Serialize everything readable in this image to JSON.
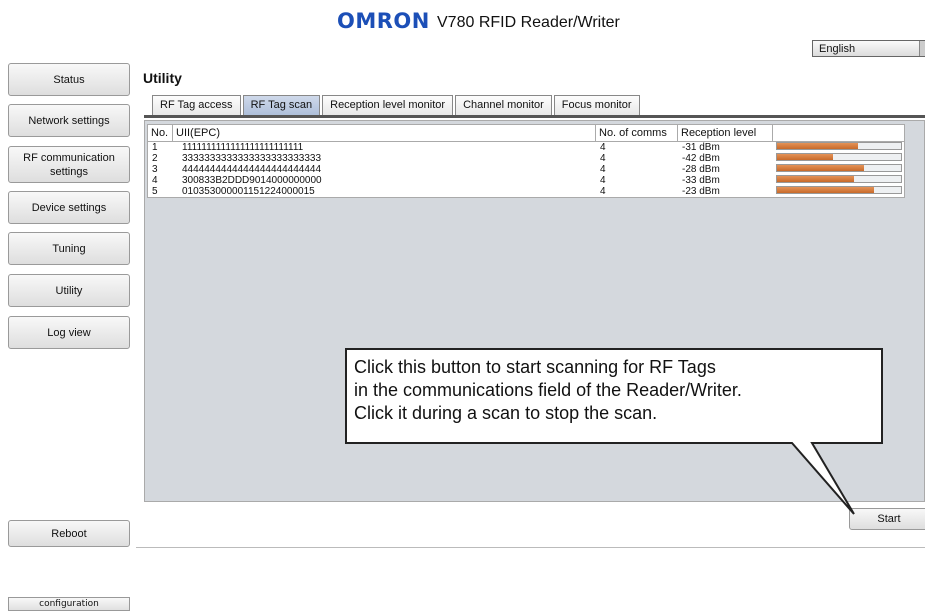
{
  "header": {
    "logo": "OMRON",
    "app_title": "V780 RFID Reader/Writer",
    "language": "English"
  },
  "sidebar": {
    "items": [
      {
        "label": "Status"
      },
      {
        "label": "Network settings"
      },
      {
        "label": "RF communication settings"
      },
      {
        "label": "Device settings"
      },
      {
        "label": "Tuning"
      },
      {
        "label": "Utility"
      },
      {
        "label": "Log view"
      }
    ],
    "reboot": "Reboot",
    "configuration": "configuration"
  },
  "main": {
    "title": "Utility",
    "tabs": [
      {
        "label": "RF Tag access",
        "active": false
      },
      {
        "label": "RF Tag scan",
        "active": true
      },
      {
        "label": "Reception level monitor",
        "active": false
      },
      {
        "label": "Channel monitor",
        "active": false
      },
      {
        "label": "Focus monitor",
        "active": false
      }
    ],
    "table": {
      "columns": [
        "No.",
        "UII(EPC)",
        "No. of comms",
        "Reception level",
        ""
      ],
      "rows": [
        {
          "no": "1",
          "uii": "1111111111111111111111111",
          "comms": "4",
          "level": "-31 dBm",
          "bar_fraction": 0.65
        },
        {
          "no": "2",
          "uii": "3333333333333333333333333",
          "comms": "4",
          "level": "-42 dBm",
          "bar_fraction": 0.45
        },
        {
          "no": "3",
          "uii": "4444444444444444444444444",
          "comms": "4",
          "level": "-28 dBm",
          "bar_fraction": 0.7
        },
        {
          "no": "4",
          "uii": "300833B2DDD9014000000000",
          "comms": "4",
          "level": "-33 dBm",
          "bar_fraction": 0.62
        },
        {
          "no": "5",
          "uii": "010353000001151224000015",
          "comms": "4",
          "level": "-23 dBm",
          "bar_fraction": 0.78
        }
      ]
    },
    "start_button": "Start"
  },
  "callout": {
    "lines": [
      "Click this button to start scanning for RF Tags",
      "in the communications field of the Reader/Writer.",
      "Click it during a scan to stop the scan."
    ]
  },
  "colors": {
    "brand": "#1c4fb7",
    "active_tab": "#aebfda",
    "bar": "#d9793a",
    "panel": "#d4d8dd"
  }
}
